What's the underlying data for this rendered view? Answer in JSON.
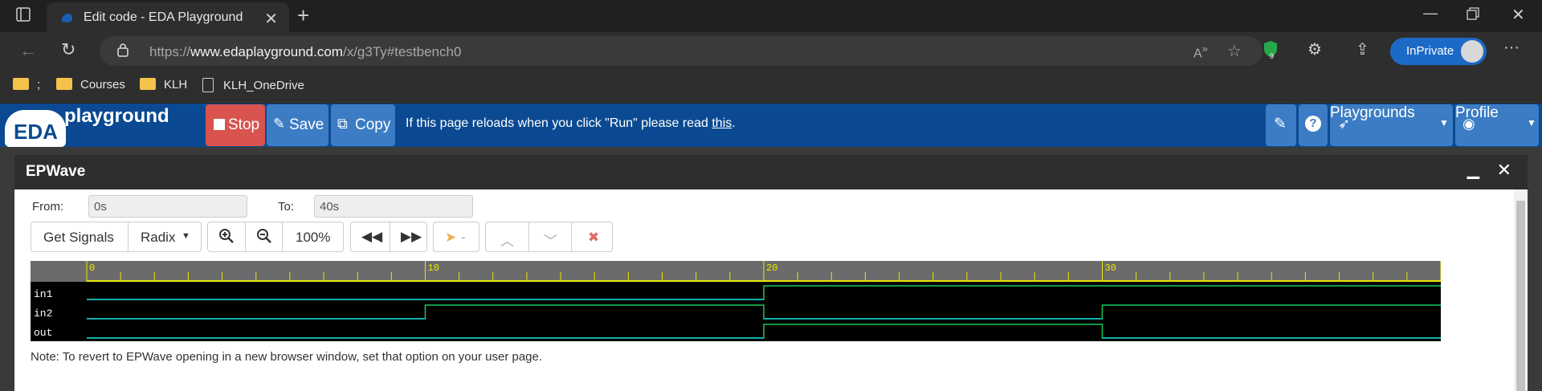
{
  "browser": {
    "tab_title": "Edit code - EDA Playground",
    "url_prefix": "https://",
    "url_host": "www.edaplayground.com",
    "url_path": "/x/g3Ty#testbench0",
    "inprivate_label": "InPrivate",
    "extension_badge": "9",
    "bookmarks": [
      {
        "label": ";",
        "type": "folder"
      },
      {
        "label": "Courses",
        "type": "folder"
      },
      {
        "label": "KLH",
        "type": "folder"
      },
      {
        "label": "KLH_OneDrive",
        "type": "page"
      }
    ]
  },
  "eda_header": {
    "logo_eda": "EDA",
    "logo_playground": "playground",
    "stop_label": "Stop",
    "save_label": "Save",
    "copy_label": "Copy",
    "notice_text": "If this page reloads when you click \"Run\" please read ",
    "notice_link": "this",
    "notice_end": ".",
    "playgrounds_label": "Playgrounds",
    "profile_label": "Profile"
  },
  "epwave": {
    "title": "EPWave",
    "from_label": "From:",
    "from_value": "0s",
    "to_label": "To:",
    "to_value": "40s",
    "get_signals_label": "Get Signals",
    "radix_label": "Radix",
    "zoom_level": "100%",
    "cursor_value": "-",
    "timeline_ticks": [
      "0",
      "10",
      "20",
      "30"
    ],
    "signals": [
      {
        "name": "in1",
        "transitions": [
          [
            0,
            0
          ],
          [
            20,
            1
          ],
          [
            40,
            1
          ]
        ]
      },
      {
        "name": "in2",
        "transitions": [
          [
            0,
            0
          ],
          [
            10,
            1
          ],
          [
            20,
            0
          ],
          [
            30,
            1
          ],
          [
            40,
            1
          ]
        ]
      },
      {
        "name": "out",
        "transitions": [
          [
            0,
            0
          ],
          [
            20,
            1
          ],
          [
            30,
            0
          ],
          [
            40,
            0
          ]
        ]
      }
    ],
    "note": "Note: To revert to EPWave opening in a new browser window, set that option on your user page."
  },
  "colors": {
    "eda_blue": "#0b4a92",
    "button_blue": "#3b7cc4",
    "stop_red": "#d9534f",
    "wave_green": "#16c75a",
    "wave_cyan": "#12c8d6",
    "timeline_yellow": "#e8e800"
  }
}
